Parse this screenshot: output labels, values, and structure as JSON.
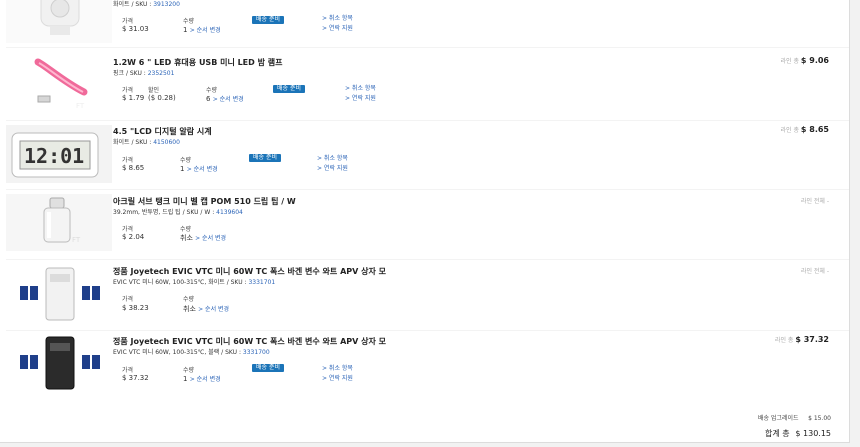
{
  "labels": {
    "price": "가격",
    "discount": "할인",
    "quantity": "수량",
    "change_qty": "> 순서 변경",
    "cancel_item": "> 취소 항목",
    "delayed_support": "> 연락 지원",
    "ready_badge": "배송 준비",
    "line_total": "라인 총",
    "line_total_none": "라인 전체 -",
    "cancelled": "취소"
  },
  "items": [
    {
      "title": "",
      "sub": "화이트 / SKU : ",
      "sku": "3913200",
      "price": "$ 31.03",
      "qty": "1"
    },
    {
      "title": "1.2W 6 \" LED 휴대용 USB 미니 LED 밤 램프",
      "sub": "핑크 / SKU : ",
      "sku": "2352501",
      "price": "$ 1.79",
      "discount": "($ 0.28)",
      "qty": "6",
      "total": "$ 9.06"
    },
    {
      "title": "4.5 \"LCD 디지털 알람 시계",
      "sub": "화이트 / SKU : ",
      "sku": "4150600",
      "price": "$ 8.65",
      "qty": "1",
      "total": "$ 8.65"
    },
    {
      "title": "아크릴 서브 탱크 미니 벨 캡 POM 510 드립 팁 / W",
      "sub": "39.2mm, 반투명, 드립 팁 / SKU / W : ",
      "sku": "4139604",
      "price": "$ 2.04"
    },
    {
      "title": "정품 Joyetech EVIC VTC 미니 60W TC 폭스 바겐 변수 와트 APV 상자 모",
      "sub": "EVIC VTC 미니 60W, 100-315℃, 화이트 / SKU : ",
      "sku": "3331701",
      "price": "$ 38.23"
    },
    {
      "title": "정품 Joyetech EVIC VTC 미니 60W TC 폭스 바겐 변수 와트 APV 상자 모",
      "sub": "EVIC VTC 미니 60W, 100-315℃, 블랙 / SKU : ",
      "sku": "3331700",
      "price": "$ 37.32",
      "qty": "1",
      "total": "$ 37.32"
    }
  ],
  "summary": {
    "shipping_label": "배송 업그레이드",
    "shipping_value": "$ 15.00",
    "grand_label": "합계 총",
    "grand_value": "$ 130.15"
  }
}
